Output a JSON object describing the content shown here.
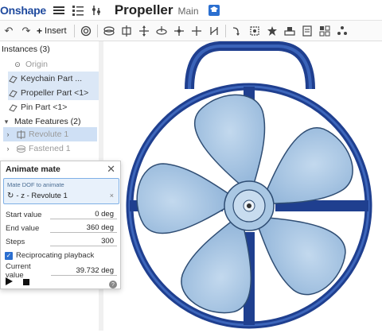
{
  "app": {
    "logo": "Onshape",
    "doc_name": "Propeller",
    "branch": "Main"
  },
  "toolbar": {
    "insert_label": "Insert"
  },
  "tree": {
    "instances_header": "Instances (3)",
    "items": [
      {
        "label": "Origin"
      },
      {
        "label": "Keychain Part ..."
      },
      {
        "label": "Propeller Part <1>"
      },
      {
        "label": "Pin Part <1>"
      }
    ],
    "mates_header": "Mate Features (2)",
    "mates": [
      {
        "label": "Revolute 1"
      },
      {
        "label": "Fastened 1"
      }
    ]
  },
  "dialog": {
    "title": "Animate mate",
    "dof_label": "Mate DOF to animate",
    "dof_value": "- z - Revolute 1",
    "fields": [
      {
        "label": "Start value",
        "value": "0 deg"
      },
      {
        "label": "End value",
        "value": "360 deg"
      },
      {
        "label": "Steps",
        "value": "300"
      }
    ],
    "reciprocating_label": "Reciprocating playback",
    "current_label": "Current value",
    "current_value": "39.732 deg"
  },
  "colors": {
    "accent": "#2b6fd0",
    "ring": "#1f3f8f",
    "blade": "#a9c7e3",
    "blade_edge": "#2f4d73"
  }
}
